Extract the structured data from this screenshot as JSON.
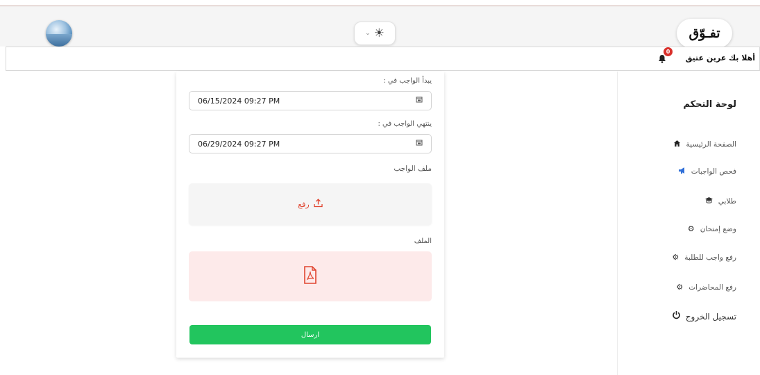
{
  "header": {
    "logo_text": "تفـوّق",
    "theme_toggle": {
      "icon": "sun-icon",
      "chevron": "⌄",
      "symbol": "☀"
    }
  },
  "subbar": {
    "welcome": "أهلا بك عرين عتيق",
    "notification_count": "0"
  },
  "sidebar": {
    "title": "لوحة التحكم",
    "items": [
      {
        "label": "الصفحة الرئيسية",
        "icon": "home-icon",
        "glyph": "⌂"
      },
      {
        "label": "فحص الواجبات",
        "icon": "megaphone-icon",
        "glyph": "📢"
      },
      {
        "label": "طلابي",
        "icon": "graduation-cap-icon",
        "glyph": "🎓"
      },
      {
        "label": "وضع إمتحان",
        "icon": "gear-icon",
        "glyph": "⚙"
      },
      {
        "label": "رفع واجب للطلبة",
        "icon": "gear-icon",
        "glyph": "⚙"
      },
      {
        "label": "رفع المحاضرات",
        "icon": "gear-icon",
        "glyph": "⚙"
      },
      {
        "label": "تسجيل الخروج",
        "icon": "power-icon",
        "glyph": "⏻"
      }
    ]
  },
  "form": {
    "start_label": "يبدأ الواجب في :",
    "start_value": "06/15/2024 09:27 PM",
    "end_label": "ينتهي الواجب في :",
    "end_value": "06/29/2024 09:27 PM",
    "file_section_label": "ملف الواجب",
    "upload_label": "رفع",
    "file_label": "الملف",
    "file_icon": "pdf-file-icon",
    "submit_label": "ارسال"
  },
  "colors": {
    "accent_green": "#22c55e",
    "upload_red": "#e0442f",
    "file_box_bg": "#fdeaea",
    "badge_red": "#d9302b"
  }
}
